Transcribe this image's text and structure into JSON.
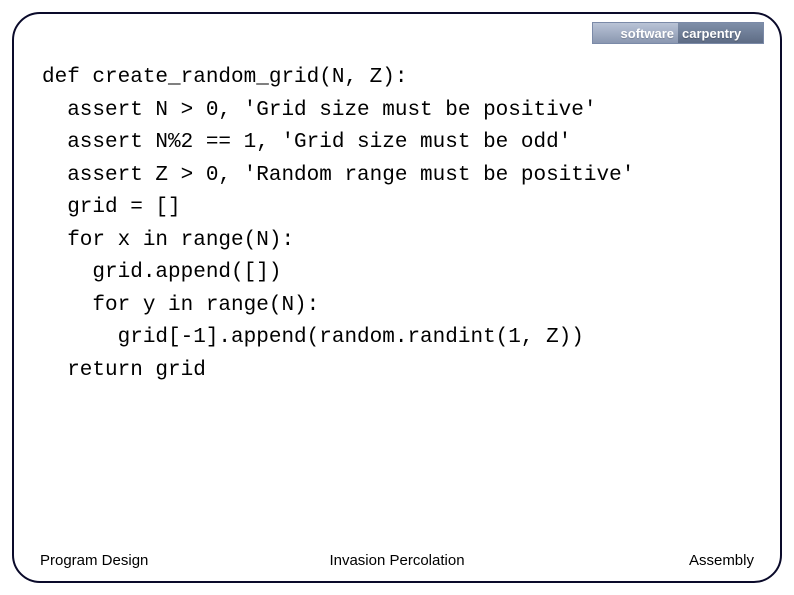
{
  "logo": {
    "word1": "software",
    "word2": "carpentry"
  },
  "code": {
    "l1": "def create_random_grid(N, Z):",
    "l2": "  assert N > 0, 'Grid size must be positive'",
    "l3": "  assert N%2 == 1, 'Grid size must be odd'",
    "l4": "  assert Z > 0, 'Random range must be positive'",
    "l5": "  grid = []",
    "l6": "  for x in range(N):",
    "l7": "    grid.append([])",
    "l8": "    for y in range(N):",
    "l9": "      grid[-1].append(random.randint(1, Z))",
    "l10": "  return grid"
  },
  "footer": {
    "left": "Program Design",
    "center": "Invasion Percolation",
    "right": "Assembly"
  }
}
